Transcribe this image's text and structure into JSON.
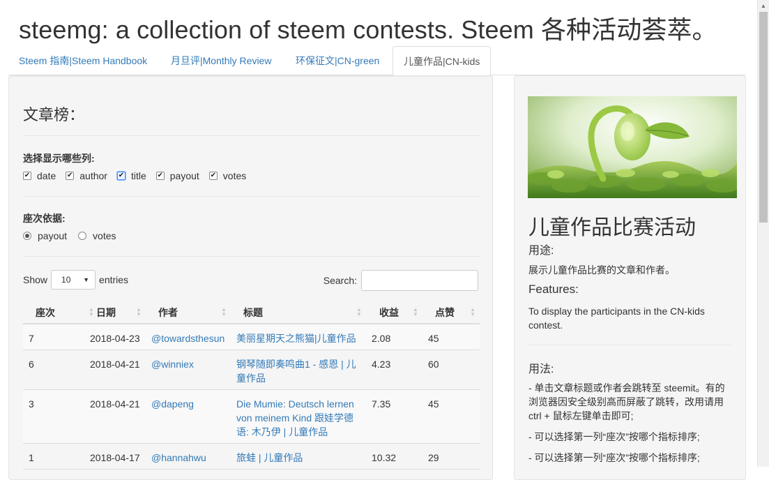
{
  "page": {
    "title": "steemg: a collection of steem contests. Steem 各种活动荟萃。"
  },
  "tabs": [
    {
      "label": "Steem 指南|Steem Handbook"
    },
    {
      "label": "月旦评|Monthly Review"
    },
    {
      "label": "环保征文|CN-green"
    },
    {
      "label": "儿童作品|CN-kids",
      "active": true
    }
  ],
  "ranking": {
    "heading": "文章榜：",
    "columns_label": "选择显示哪些列:",
    "columns_options": [
      {
        "label": "date",
        "checked": true
      },
      {
        "label": "author",
        "checked": true
      },
      {
        "label": "title",
        "checked": true
      },
      {
        "label": "payout",
        "checked": true
      },
      {
        "label": "votes",
        "checked": true
      }
    ],
    "rank_label": "座次依据:",
    "rank_options": [
      {
        "label": "payout",
        "selected": true
      },
      {
        "label": "votes",
        "selected": false
      }
    ],
    "show_label": "Show",
    "entries_value": "10",
    "entries_label": "entries",
    "search_label": "Search:",
    "search_value": ""
  },
  "table": {
    "headers": [
      "座次",
      "日期",
      "作者",
      "标题",
      "收益",
      "点赞"
    ],
    "rows": [
      {
        "rank": "7",
        "date": "2018-04-23",
        "author": "@towardsthesun",
        "title_lines": [
          "美丽星期天之熊猫|儿童作品"
        ],
        "payout": "2.08",
        "votes": "45"
      },
      {
        "rank": "6",
        "date": "2018-04-21",
        "author": "@winniex",
        "title_lines": [
          "钢琴随即奏鸣曲1 - 感恩 | 儿",
          "童作品"
        ],
        "payout": "4.23",
        "votes": "60"
      },
      {
        "rank": "3",
        "date": "2018-04-21",
        "author": "@dapeng",
        "title_lines": [
          "Die Mumie: Deutsch lernen",
          "von meinem Kind 跟娃学德",
          "语: 木乃伊 | 儿童作品"
        ],
        "payout": "7.35",
        "votes": "45"
      },
      {
        "rank": "1",
        "date": "2018-04-17",
        "author": "@hannahwu",
        "title_lines": [
          "旅蛙 | 儿童作品"
        ],
        "payout": "10.32",
        "votes": "29"
      }
    ]
  },
  "sidebar": {
    "image_alt": "sprouting seedling",
    "title": "儿童作品比赛活动",
    "purpose_label": "用途:",
    "purpose_text": "展示儿童作品比赛的文章和作者。",
    "features_label": "Features:",
    "features_text": "To display the participants in the CN-kids contest.",
    "usage_label": "用法:",
    "usage_items": [
      "- 单击文章标题或作者会跳转至 steemit。有的浏览器因安全级别高而屏蔽了跳转，改用请用 ctrl + 鼠标左键单击即可;",
      "- 可以选择第一列“座次”按哪个指标排序;",
      "- 可以选择第一列“座次”按哪个指标排序;"
    ]
  },
  "colors": {
    "link": "#337ab7",
    "panel_bg": "#f5f5f5",
    "text": "#333333"
  }
}
